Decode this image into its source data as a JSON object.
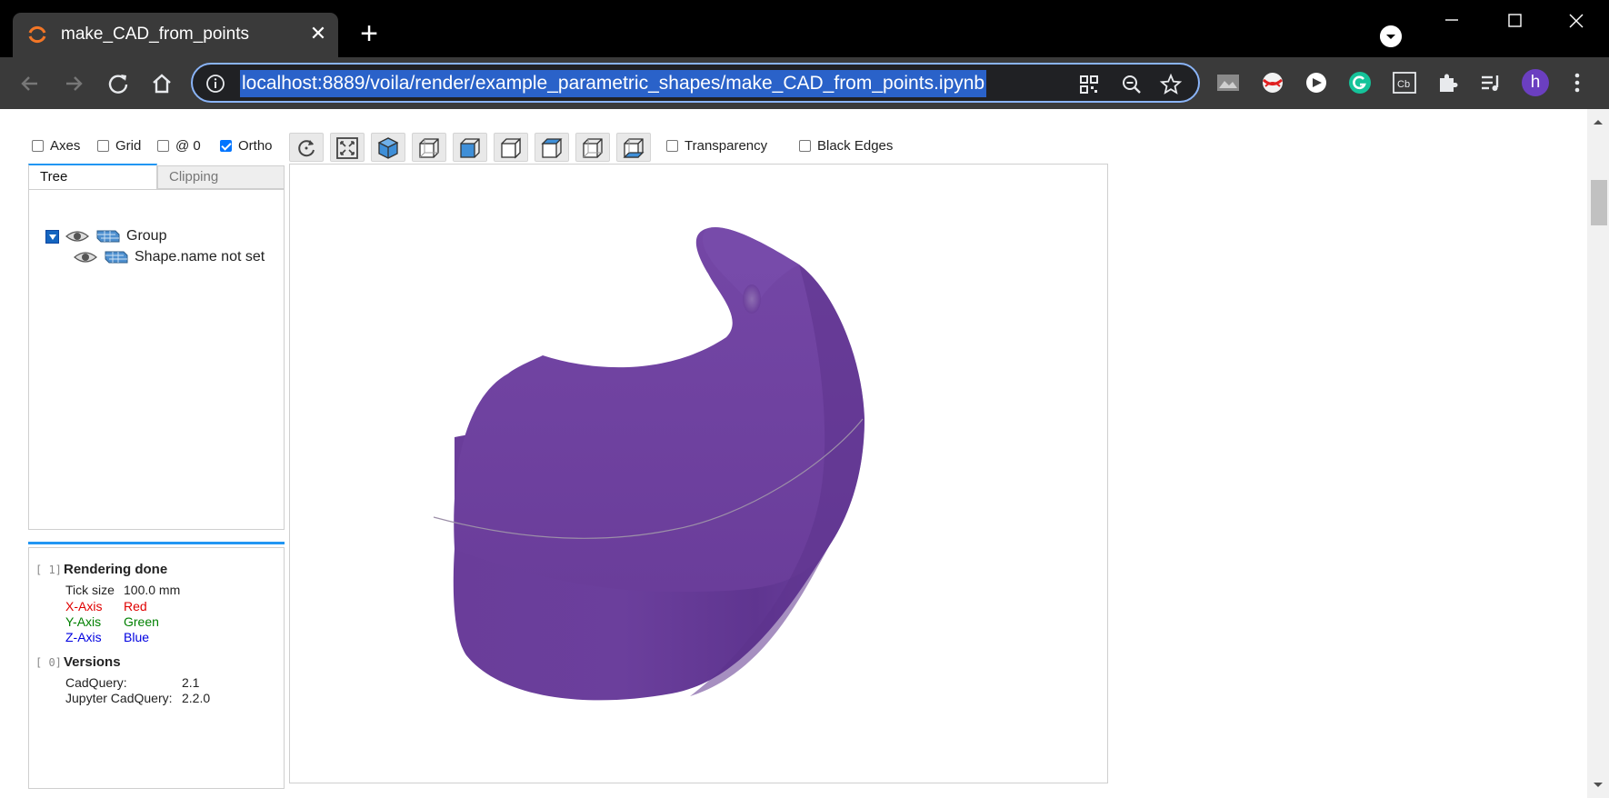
{
  "browser": {
    "tab_title": "make_CAD_from_points",
    "close_glyph": "✕",
    "new_tab_glyph": "+",
    "url": "localhost:8889/voila/render/example_parametric_shapes/make_CAD_from_points.ipynb",
    "avatar_letter": "h",
    "accent_color": "#8ab4f8"
  },
  "toolbar": {
    "axes_label": "Axes",
    "grid_label": "Grid",
    "at0_label": "@ 0",
    "ortho_label": "Ortho",
    "transparency_label": "Transparency",
    "black_edges_label": "Black Edges",
    "axes_checked": false,
    "grid_checked": false,
    "at0_checked": false,
    "ortho_checked": true,
    "transparency_checked": false,
    "black_edges_checked": false
  },
  "panel": {
    "tab_tree": "Tree",
    "tab_clipping": "Clipping",
    "tree": {
      "group_label": "Group",
      "shape_label": "Shape.name not set"
    }
  },
  "log": {
    "entry1": {
      "index": "[ 1]",
      "title": "Rendering done",
      "tick_label": "Tick size",
      "tick_value": "100.0 mm",
      "x_axis": "X-Axis",
      "x_color": "Red",
      "y_axis": "Y-Axis",
      "y_color": "Green",
      "z_axis": "Z-Axis",
      "z_color": "Blue"
    },
    "entry0": {
      "index": "[ 0]",
      "title": "Versions",
      "cadquery_label": "CadQuery:",
      "cadquery_version": "2.1",
      "jupyter_label": "Jupyter CadQuery:",
      "jupyter_version": "2.2.0"
    }
  },
  "model": {
    "color": "#6a3d9a",
    "edge_color": "#9c8fa8"
  }
}
